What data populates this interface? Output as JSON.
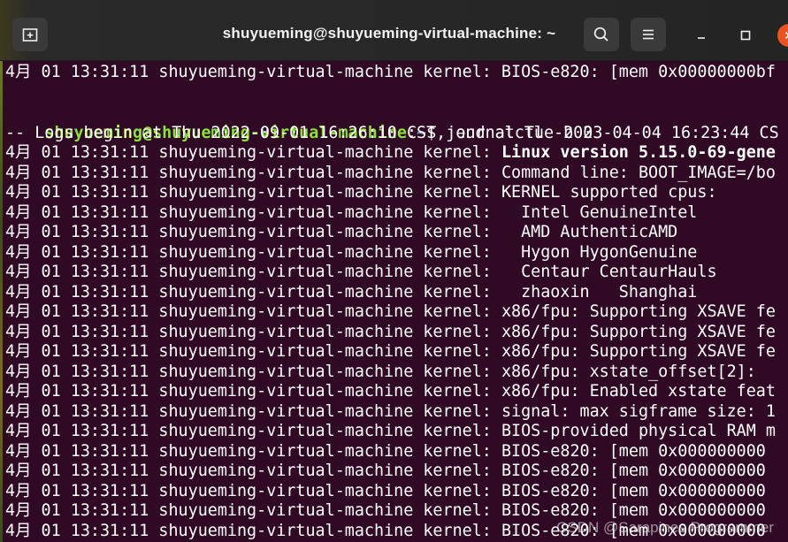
{
  "window": {
    "title": "shuyueming@shuyueming-virtual-machine: ~",
    "accent_close": "#e95420"
  },
  "icons": {
    "new_tab": "new-tab-icon",
    "search": "search-icon",
    "menu": "hamburger-menu-icon",
    "minimize": "minimize-icon",
    "maximize": "maximize-icon",
    "close": "close-icon"
  },
  "terminal": {
    "line_first": "4月 01 13:31:11 shuyueming-virtual-machine kernel: BIOS-e820: [mem 0x00000000bf",
    "prompt": {
      "user": "shuyueming@shuyueming-virtual-machine",
      "sep": ":",
      "path": "~",
      "dollar": "$ ",
      "command": "journalctl -b 0"
    },
    "logs_begin": "-- Logs begin at Thu 2022-09-01 16:26:10 CST, end at Tue 2023-04-04 16:23:44 CS",
    "log_prefix": "4月 01 13:31:11 shuyueming-virtual-machine kernel: ",
    "log_messages": [
      "Linux version 5.15.0-69-gene",
      "Command line: BOOT_IMAGE=/bo",
      "KERNEL supported cpus:",
      "  Intel GenuineIntel",
      "  AMD AuthenticAMD",
      "  Hygon HygonGenuine",
      "  Centaur CentaurHauls",
      "  zhaoxin   Shanghai",
      "x86/fpu: Supporting XSAVE fe",
      "x86/fpu: Supporting XSAVE fe",
      "x86/fpu: Supporting XSAVE fe",
      "x86/fpu: xstate_offset[2]:",
      "x86/fpu: Enabled xstate feat",
      "signal: max sigframe size: 1",
      "BIOS-provided physical RAM m",
      "BIOS-e820: [mem 0x000000000",
      "BIOS-e820: [mem 0x000000000",
      "BIOS-e820: [mem 0x000000000",
      "BIOS-e820: [mem 0x000000000",
      "BIOS-e820: [mem 0x000000000"
    ]
  },
  "watermark": "CSDN @Sarapines Programmer"
}
